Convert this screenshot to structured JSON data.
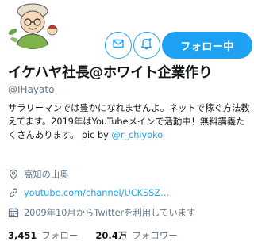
{
  "profile": {
    "name": "イケハヤ社長@ホワイト企業作り",
    "handle": "@IHayato",
    "bio_text": "サラリーマンでは豊かになれませんよ。ネットで稼ぐ方法教えてます。2019年はYouTubeメインで活動中！無料講義たくさんあります。 pic by ",
    "bio_mention": "@r_chiyoko"
  },
  "actions": {
    "follow_label": "フォロー中",
    "dm_icon": "mail-icon",
    "notify_icon": "bell-plus-icon"
  },
  "meta": {
    "location": "高知の山奥",
    "url": "youtube.com/channel/UCKSSZ…",
    "joined": "2009年10月からTwitterを利用しています"
  },
  "stats": {
    "following_count": "3,451",
    "following_label": "フォロー",
    "followers_count": "20.4万",
    "followers_label": "フォロワー"
  },
  "colors": {
    "accent": "#1da1f2",
    "secondary_text": "#657786",
    "primary_text": "#14171a"
  }
}
